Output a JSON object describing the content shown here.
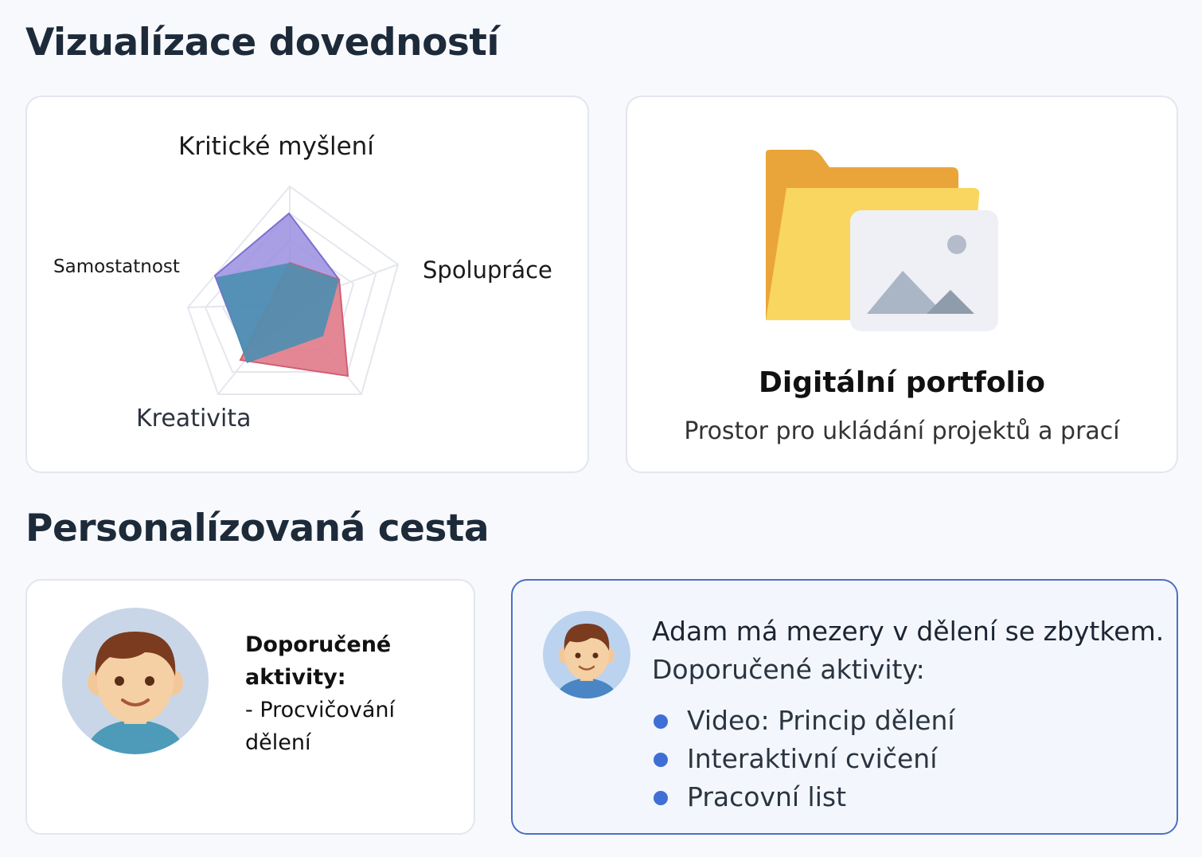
{
  "sections": {
    "skills_title": "Vizualízace dovedností",
    "path_title": "Personalízovaná cesta"
  },
  "radar": {
    "axes": [
      "Kritické myšlení",
      "Spolupráce",
      "Samostatnost",
      "Kreativita"
    ],
    "colors": {
      "purple": "#9a8ee0",
      "red": "#e07a8a",
      "teal": "#4b8fb0",
      "grid": "#e4e7ee"
    }
  },
  "portfolio": {
    "icon": "folder-image-icon",
    "title": "Digitální portfolio",
    "description": "Prostor pro ukládání projektů a prací"
  },
  "activities": {
    "heading": "Doporučené aktivity:",
    "item": "- Procvičování dělení"
  },
  "alert": {
    "line1": "Adam má mezery v dělení se zbytkem.",
    "line2": "Doporučené aktivity:",
    "items": [
      "Video: Princip dělení",
      "Interaktivní cvičení",
      "Pracovní list"
    ],
    "accent": "#3f6fd6"
  }
}
